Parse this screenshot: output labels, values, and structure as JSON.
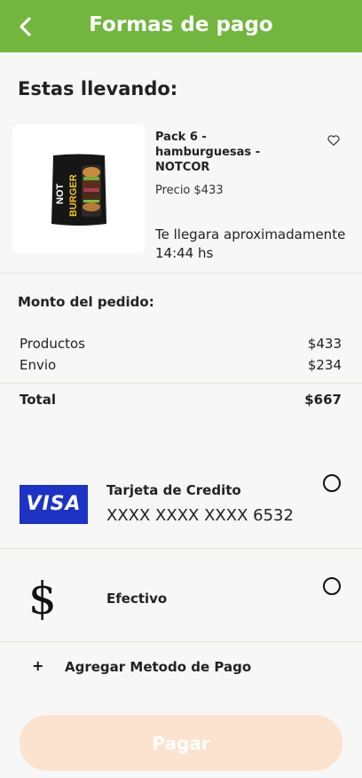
{
  "header": {
    "title": "Formas de pago"
  },
  "summary": {
    "heading": "Estas llevando:",
    "product": {
      "name": "Pack 6 - hamburguesas - NOTCOR",
      "price": "Precio $433",
      "eta": "Te llegara aproximadamente 14:44 hs",
      "image_text_top": "NOT",
      "image_text_bottom": "BURGER"
    }
  },
  "order": {
    "heading": "Monto del pedido:",
    "rows": [
      {
        "label": "Productos",
        "value": "$433"
      },
      {
        "label": "Envio",
        "value": "$234"
      }
    ],
    "total": {
      "label": "Total",
      "value": "$667"
    }
  },
  "payment_methods": [
    {
      "brand": "VISA",
      "label": "Tarjeta de Credito",
      "number": "XXXX XXXX XXXX 6532",
      "selected": false
    },
    {
      "symbol": "$",
      "label": "Efectivo",
      "selected": false
    }
  ],
  "add_method": {
    "icon": "+",
    "label": "Agregar Metodo de Pago"
  },
  "pay_button": {
    "label": "Pagar"
  },
  "colors": {
    "header": "#72b53f",
    "visa": "#1c33c5",
    "pay_button": "#fce3cf"
  }
}
